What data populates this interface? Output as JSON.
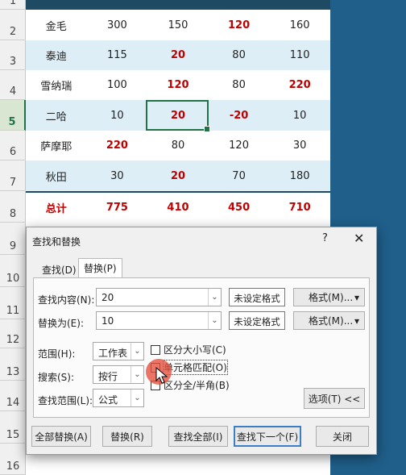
{
  "row_headers": [
    "1",
    "2",
    "3",
    "4",
    "5",
    "6",
    "7",
    "8",
    "9",
    "10",
    "11",
    "12",
    "13",
    "14",
    "15",
    "16"
  ],
  "table": {
    "rows": [
      {
        "name": "金毛",
        "values": [
          "300",
          "150",
          "120",
          "160"
        ],
        "red": [
          false,
          false,
          true,
          false
        ]
      },
      {
        "name": "泰迪",
        "values": [
          "115",
          "20",
          "80",
          "110"
        ],
        "red": [
          false,
          true,
          false,
          false
        ]
      },
      {
        "name": "雪纳瑞",
        "values": [
          "100",
          "120",
          "80",
          "220"
        ],
        "red": [
          false,
          true,
          false,
          true
        ]
      },
      {
        "name": "二哈",
        "values": [
          "10",
          "20",
          "-20",
          "10"
        ],
        "red": [
          false,
          true,
          true,
          false
        ]
      },
      {
        "name": "萨摩耶",
        "values": [
          "220",
          "80",
          "120",
          "30"
        ],
        "red": [
          true,
          false,
          false,
          false
        ]
      },
      {
        "name": "秋田",
        "values": [
          "30",
          "20",
          "70",
          "180"
        ],
        "red": [
          false,
          true,
          false,
          false
        ]
      }
    ],
    "total": {
      "name": "总计",
      "values": [
        "775",
        "410",
        "450",
        "710"
      ]
    }
  },
  "dialog": {
    "title": "查找和替换",
    "help": "?",
    "close": "✕",
    "tabs": {
      "find": "查找(D)",
      "replace": "替换(P)"
    },
    "find_label": "查找内容(N):",
    "find_value": "20",
    "replace_label": "替换为(E):",
    "replace_value": "10",
    "no_format": "未设定格式",
    "format_btn": "格式(M)...",
    "scope_label": "范围(H):",
    "scope_value": "工作表",
    "search_label": "搜索(S):",
    "search_value": "按行",
    "lookin_label": "查找范围(L):",
    "lookin_value": "公式",
    "match_case": "区分大小写(C)",
    "match_cell": "单元格匹配(O)",
    "match_width": "区分全/半角(B)",
    "options_btn": "选项(T) <<",
    "buttons": {
      "replace_all": "全部替换(A)",
      "replace": "替换(R)",
      "find_all": "查找全部(I)",
      "find_next": "查找下一个(F)",
      "close": "关闭"
    }
  },
  "colors": {
    "accent_red": "#c00000",
    "selection_green": "#217346",
    "row_blue": "#ddeef6"
  }
}
